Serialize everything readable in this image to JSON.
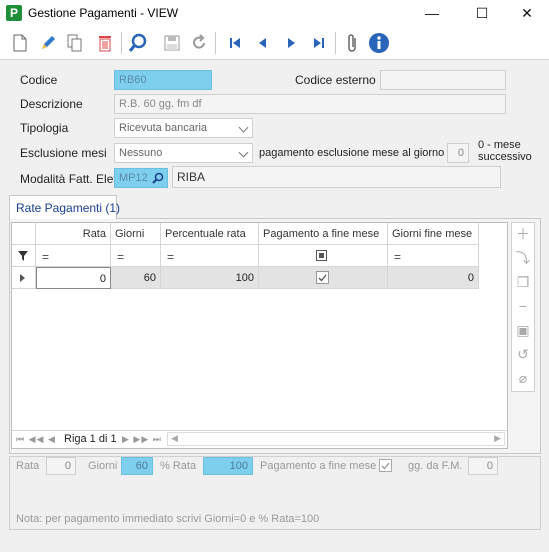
{
  "window": {
    "title": "Gestione Pagamenti - VIEW",
    "app_icon": "P",
    "minimize": "—",
    "maximize": "☐",
    "close": "✕"
  },
  "toolbar": {
    "icons": [
      "new-icon",
      "edit-icon",
      "copy-icon",
      "delete-icon",
      "search-icon",
      "save-icon",
      "undo-icon",
      "first-icon",
      "prev-icon",
      "next-icon",
      "last-icon",
      "attach-icon",
      "info-icon"
    ]
  },
  "form": {
    "codice_label": "Codice",
    "codice_value": "RB60",
    "codice_esterno_label": "Codice esterno",
    "codice_esterno_value": "",
    "descrizione_label": "Descrizione",
    "descrizione_value": "R.B. 60 gg. fm df",
    "tipologia_label": "Tipologia",
    "tipologia_value": "Ricevuta bancaria",
    "esclusione_label": "Esclusione mesi",
    "esclusione_value": "Nessuno",
    "pagamento_esclusione_label": "pagamento esclusione mese al giorno",
    "pagamento_esclusione_value": "0",
    "mese_successivo_label": "0 - mese successivo",
    "modalita_label": "Modalità Fatt. Elet.",
    "modalita_code": "MP12",
    "modalita_desc": "RIBA"
  },
  "tab": {
    "label": "Rate Pagamenti (1)"
  },
  "grid": {
    "columns": [
      "Rata",
      "Giorni",
      "Percentuale rata",
      "Pagamento a fine mese",
      "Giorni fine mese"
    ],
    "filter_symbol": "=",
    "rows": [
      {
        "rata": "0",
        "giorni": "60",
        "percentuale": "100",
        "fine_mese": true,
        "giorni_fine_mese": "0"
      }
    ],
    "pager_text": "Riga 1 di 1"
  },
  "footer": {
    "rata_label": "Rata",
    "rata_value": "0",
    "giorni_label": "Giorni",
    "giorni_value": "60",
    "perc_label": "% Rata",
    "perc_value": "100",
    "fine_mese_label": "Pagamento a fine mese",
    "gg_fm_label": "gg. da F.M.",
    "gg_fm_value": "0",
    "note": "Nota: per pagamento immediato scrivi Giorni=0 e % Rata=100"
  },
  "colors": {
    "accent_field": "#7ecfee",
    "brand_icon": "#1f8f3a",
    "tab_text": "#1a3f8f"
  }
}
